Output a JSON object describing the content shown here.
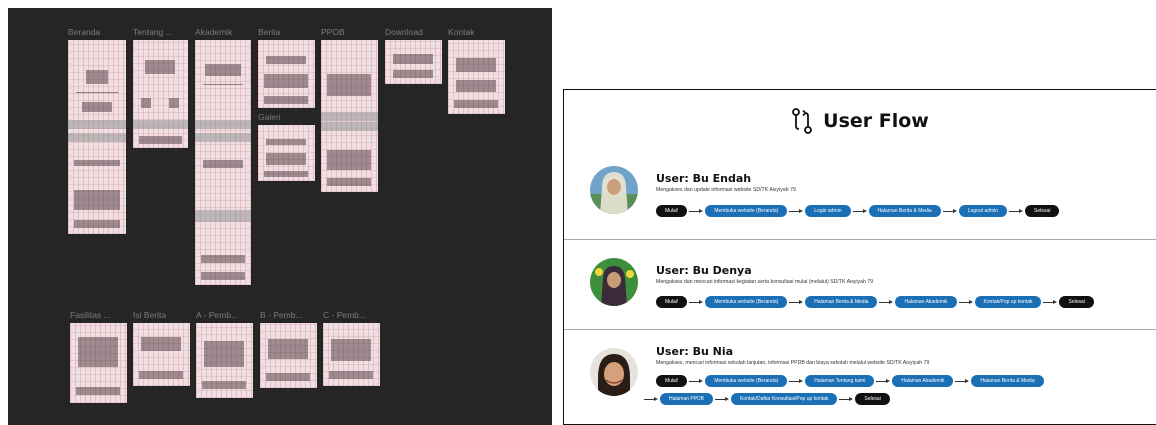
{
  "canvas": {
    "frames": [
      {
        "title": "Beranda"
      },
      {
        "title": "Tentang ..."
      },
      {
        "title": "Akademik"
      },
      {
        "title": "Berita"
      },
      {
        "title": "PPOB"
      },
      {
        "title": "Download"
      },
      {
        "title": "Kontak"
      },
      {
        "title": "Galeri"
      },
      {
        "title": "Fasilitas ..."
      },
      {
        "title": "Isi Berita"
      },
      {
        "title": "A - Pemb..."
      },
      {
        "title": "B - Pemb..."
      },
      {
        "title": "C - Pemb..."
      }
    ]
  },
  "flow": {
    "title": "User Flow",
    "icon": "git-compare-icon",
    "personas": [
      {
        "name": "User: Bu Endah",
        "desc": "Mengakses dan update informasi website SD/TK Aisyiyah 79",
        "steps": [
          {
            "label": "Mulai!",
            "kind": "dark"
          },
          {
            "label": "Membuka website (Beranda)",
            "kind": "blue"
          },
          {
            "label": "Login admin",
            "kind": "blue"
          },
          {
            "label": "Halaman Berita & Media",
            "kind": "blue"
          },
          {
            "label": "Logout admin",
            "kind": "blue"
          },
          {
            "label": "Selesai",
            "kind": "dark"
          }
        ]
      },
      {
        "name": "User: Bu Denya",
        "desc": "Mengakses dan mencari informasi kegiatan serta konsultasi mulai (melalui) SD/TK Aisyiyah 79",
        "steps": [
          {
            "label": "Mulai!",
            "kind": "dark"
          },
          {
            "label": "Membuka website (Beranda)",
            "kind": "blue"
          },
          {
            "label": "Halaman Berita & Media",
            "kind": "blue"
          },
          {
            "label": "Halaman Akademik",
            "kind": "blue"
          },
          {
            "label": "Kontak/Pop up kontak",
            "kind": "blue"
          },
          {
            "label": "Selesai",
            "kind": "dark"
          }
        ]
      },
      {
        "name": "User: Bu Nia",
        "desc": "Mengakses, mencari informasi sekolah lanjutan, informasi PPDB dan biaya sekolah melalui website SD/TK Aisyiyah 79",
        "steps": [
          {
            "label": "Mulai!",
            "kind": "dark"
          },
          {
            "label": "Membuka website (Beranda)",
            "kind": "blue"
          },
          {
            "label": "Halaman Tentang kami",
            "kind": "blue"
          },
          {
            "label": "Halaman Akademik",
            "kind": "blue"
          },
          {
            "label": "Halaman Berita & Media",
            "kind": "blue"
          },
          {
            "label": "Halaman PPDB",
            "kind": "blue"
          },
          {
            "label": "Kontak/Daftar Konsultasi/Pop up kontak",
            "kind": "blue"
          },
          {
            "label": "Selesai",
            "kind": "dark"
          }
        ]
      }
    ]
  },
  "colors": {
    "canvas_bg": "#252525",
    "wireframe_pink": "#f0e0e3",
    "pill_blue": "#1a6fb5",
    "pill_dark": "#111111"
  }
}
